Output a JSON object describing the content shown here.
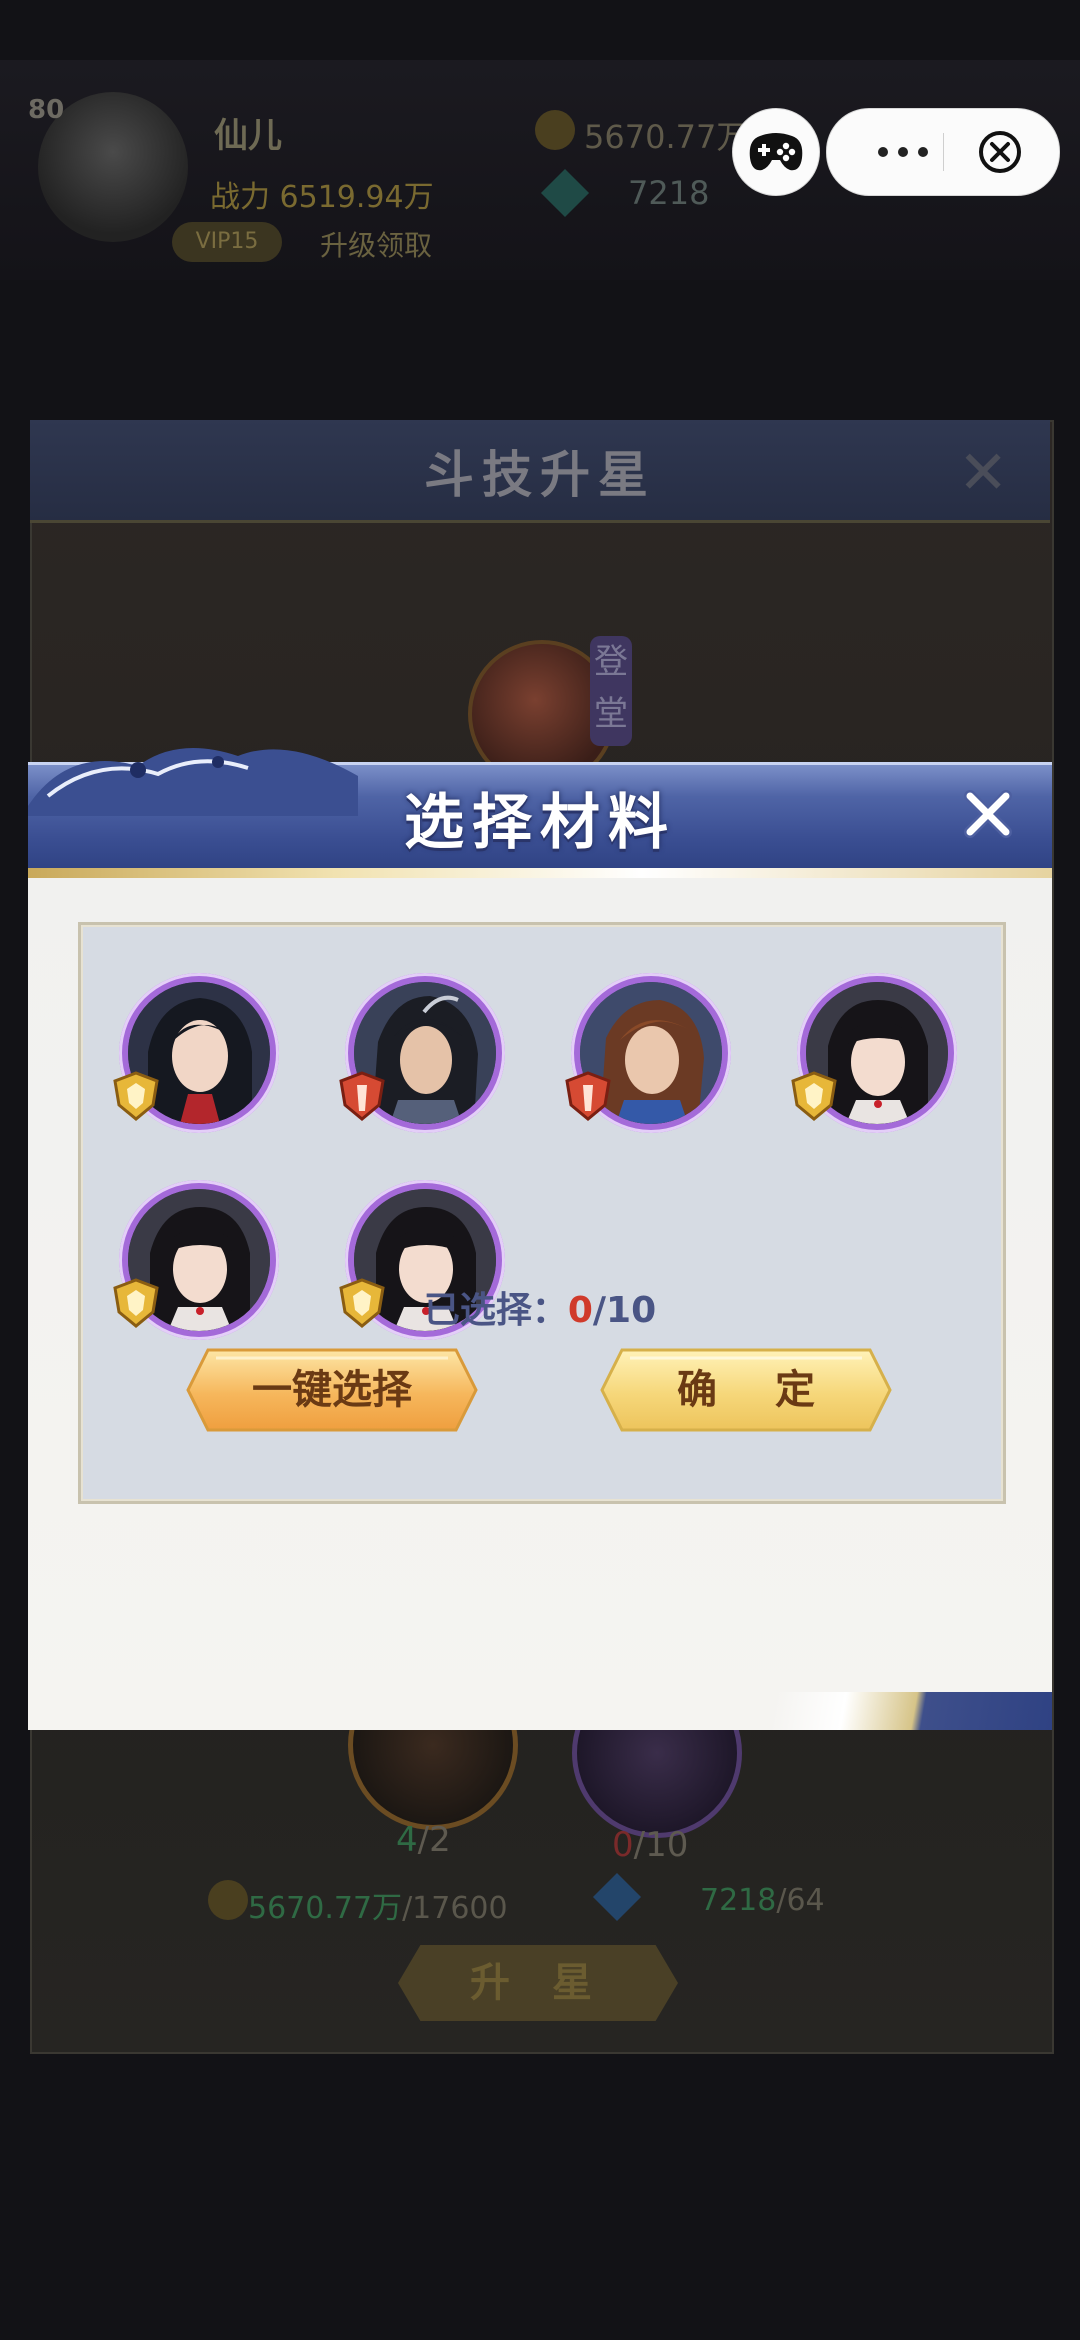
{
  "background": {
    "player_level": "80",
    "player_name": "仙儿",
    "player_power": "战力 6519.94万",
    "tag_vip": "VIP15",
    "tag_action": "升级领取",
    "coins": "5670.77万",
    "gems": "7218",
    "panel_title": "斗技升星",
    "hero_rank": "登堂",
    "slot1_have": "4",
    "slot1_need": "/2",
    "slot2_have": "0",
    "slot2_need": "/10",
    "cost_coin_have": "5670.77万",
    "cost_coin_need": "/17600",
    "cost_gem_have": "7218",
    "cost_gem_need": "/64",
    "upstar_label": "升 星"
  },
  "modal": {
    "title": "选择材料",
    "selected_label": "已选择：",
    "selected_count": "0",
    "selected_max": "/10",
    "auto_select_label": "一键选择",
    "confirm_label": "确 定"
  },
  "heroes": [
    {
      "name": "hero-1",
      "badge": "gold"
    },
    {
      "name": "hero-2",
      "badge": "red"
    },
    {
      "name": "hero-3",
      "badge": "red"
    },
    {
      "name": "hero-4",
      "badge": "gold"
    },
    {
      "name": "hero-5",
      "badge": "gold"
    },
    {
      "name": "hero-6",
      "badge": "gold"
    }
  ],
  "colors": {
    "header_blue": "#3a4e92",
    "ring_purple": "#a46ad9",
    "count_red": "#d03a2b",
    "button_gold": "#f4c46a"
  },
  "icons": {
    "game_controller": "game-controller-icon",
    "more": "more-dots-icon",
    "close_capsule": "close-circle-icon",
    "modal_close": "close-icon",
    "gold_badge": "gold-shield-badge-icon",
    "red_badge": "red-shield-badge-icon"
  }
}
